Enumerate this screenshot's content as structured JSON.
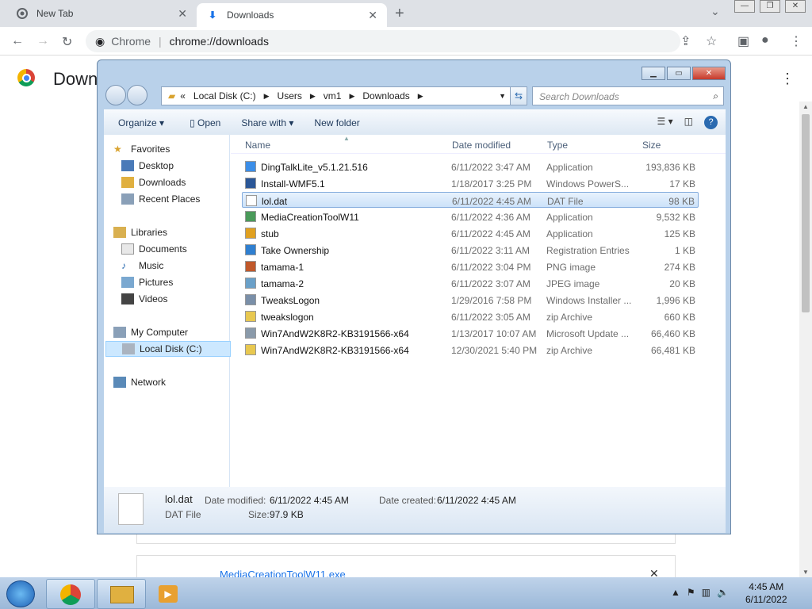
{
  "chrome": {
    "tabs": [
      {
        "title": "New Tab",
        "icon": "chrome-icon"
      },
      {
        "title": "Downloads",
        "icon": "download-icon"
      }
    ],
    "url_origin": "Chrome",
    "url_path": "chrome://downloads",
    "page_title": "Down"
  },
  "downloads_page": {
    "file_link": "MediaCreationToolW11.exe"
  },
  "explorer": {
    "address": {
      "prefix": "«",
      "crumbs": [
        "Local Disk (C:)",
        "Users",
        "vm1",
        "Downloads"
      ]
    },
    "search_placeholder": "Search Downloads",
    "toolbar": {
      "organize": "Organize",
      "open": "Open",
      "share": "Share with",
      "new_folder": "New folder"
    },
    "nav": {
      "favorites": "Favorites",
      "desktop": "Desktop",
      "downloads": "Downloads",
      "recent": "Recent Places",
      "libraries": "Libraries",
      "documents": "Documents",
      "music": "Music",
      "pictures": "Pictures",
      "videos": "Videos",
      "computer": "My Computer",
      "local_disk": "Local Disk (C:)",
      "network": "Network"
    },
    "columns": {
      "name": "Name",
      "date": "Date modified",
      "type": "Type",
      "size": "Size"
    },
    "files": [
      {
        "name": "DingTalkLite_v5.1.21.516",
        "date": "6/11/2022 3:47 AM",
        "type": "Application",
        "size": "193,836 KB",
        "icon": "app-icon",
        "color": "#3b8ee8"
      },
      {
        "name": "Install-WMF5.1",
        "date": "1/18/2017 3:25 PM",
        "type": "Windows PowerS...",
        "size": "17 KB",
        "icon": "script-icon",
        "color": "#2b5797"
      },
      {
        "name": "lol.dat",
        "date": "6/11/2022 4:45 AM",
        "type": "DAT File",
        "size": "98 KB",
        "icon": "file-icon",
        "color": "#ffffff"
      },
      {
        "name": "MediaCreationToolW11",
        "date": "6/11/2022 4:36 AM",
        "type": "Application",
        "size": "9,532 KB",
        "icon": "app-icon",
        "color": "#4a9a5a"
      },
      {
        "name": "stub",
        "date": "6/11/2022 4:45 AM",
        "type": "Application",
        "size": "125 KB",
        "icon": "app-icon",
        "color": "#e0a020"
      },
      {
        "name": "Take Ownership",
        "date": "6/11/2022 3:11 AM",
        "type": "Registration Entries",
        "size": "1 KB",
        "icon": "registry-icon",
        "color": "#2f7fd0"
      },
      {
        "name": "tamama-1",
        "date": "6/11/2022 3:04 PM",
        "type": "PNG image",
        "size": "274 KB",
        "icon": "image-icon",
        "color": "#c0582a"
      },
      {
        "name": "tamama-2",
        "date": "6/11/2022 3:07 AM",
        "type": "JPEG image",
        "size": "20 KB",
        "icon": "image-icon",
        "color": "#6aa0c8"
      },
      {
        "name": "TweaksLogon",
        "date": "1/29/2016 7:58 PM",
        "type": "Windows Installer ...",
        "size": "1,996 KB",
        "icon": "installer-icon",
        "color": "#7a8fa8"
      },
      {
        "name": "tweakslogon",
        "date": "6/11/2022 3:05 AM",
        "type": "zip Archive",
        "size": "660 KB",
        "icon": "zip-icon",
        "color": "#e8c850"
      },
      {
        "name": "Win7AndW2K8R2-KB3191566-x64",
        "date": "1/13/2017 10:07 AM",
        "type": "Microsoft Update ...",
        "size": "66,460 KB",
        "icon": "update-icon",
        "color": "#8a9aaa"
      },
      {
        "name": "Win7AndW2K8R2-KB3191566-x64",
        "date": "12/30/2021 5:40 PM",
        "type": "zip Archive",
        "size": "66,481 KB",
        "icon": "zip-icon",
        "color": "#e8c850"
      }
    ],
    "details": {
      "name": "lol.dat",
      "type": "DAT File",
      "date_modified_label": "Date modified:",
      "date_modified": "6/11/2022 4:45 AM",
      "date_created_label": "Date created:",
      "date_created": "6/11/2022 4:45 AM",
      "size_label": "Size:",
      "size": "97.9 KB"
    }
  },
  "taskbar": {
    "time": "4:45 AM",
    "date": "6/11/2022"
  }
}
